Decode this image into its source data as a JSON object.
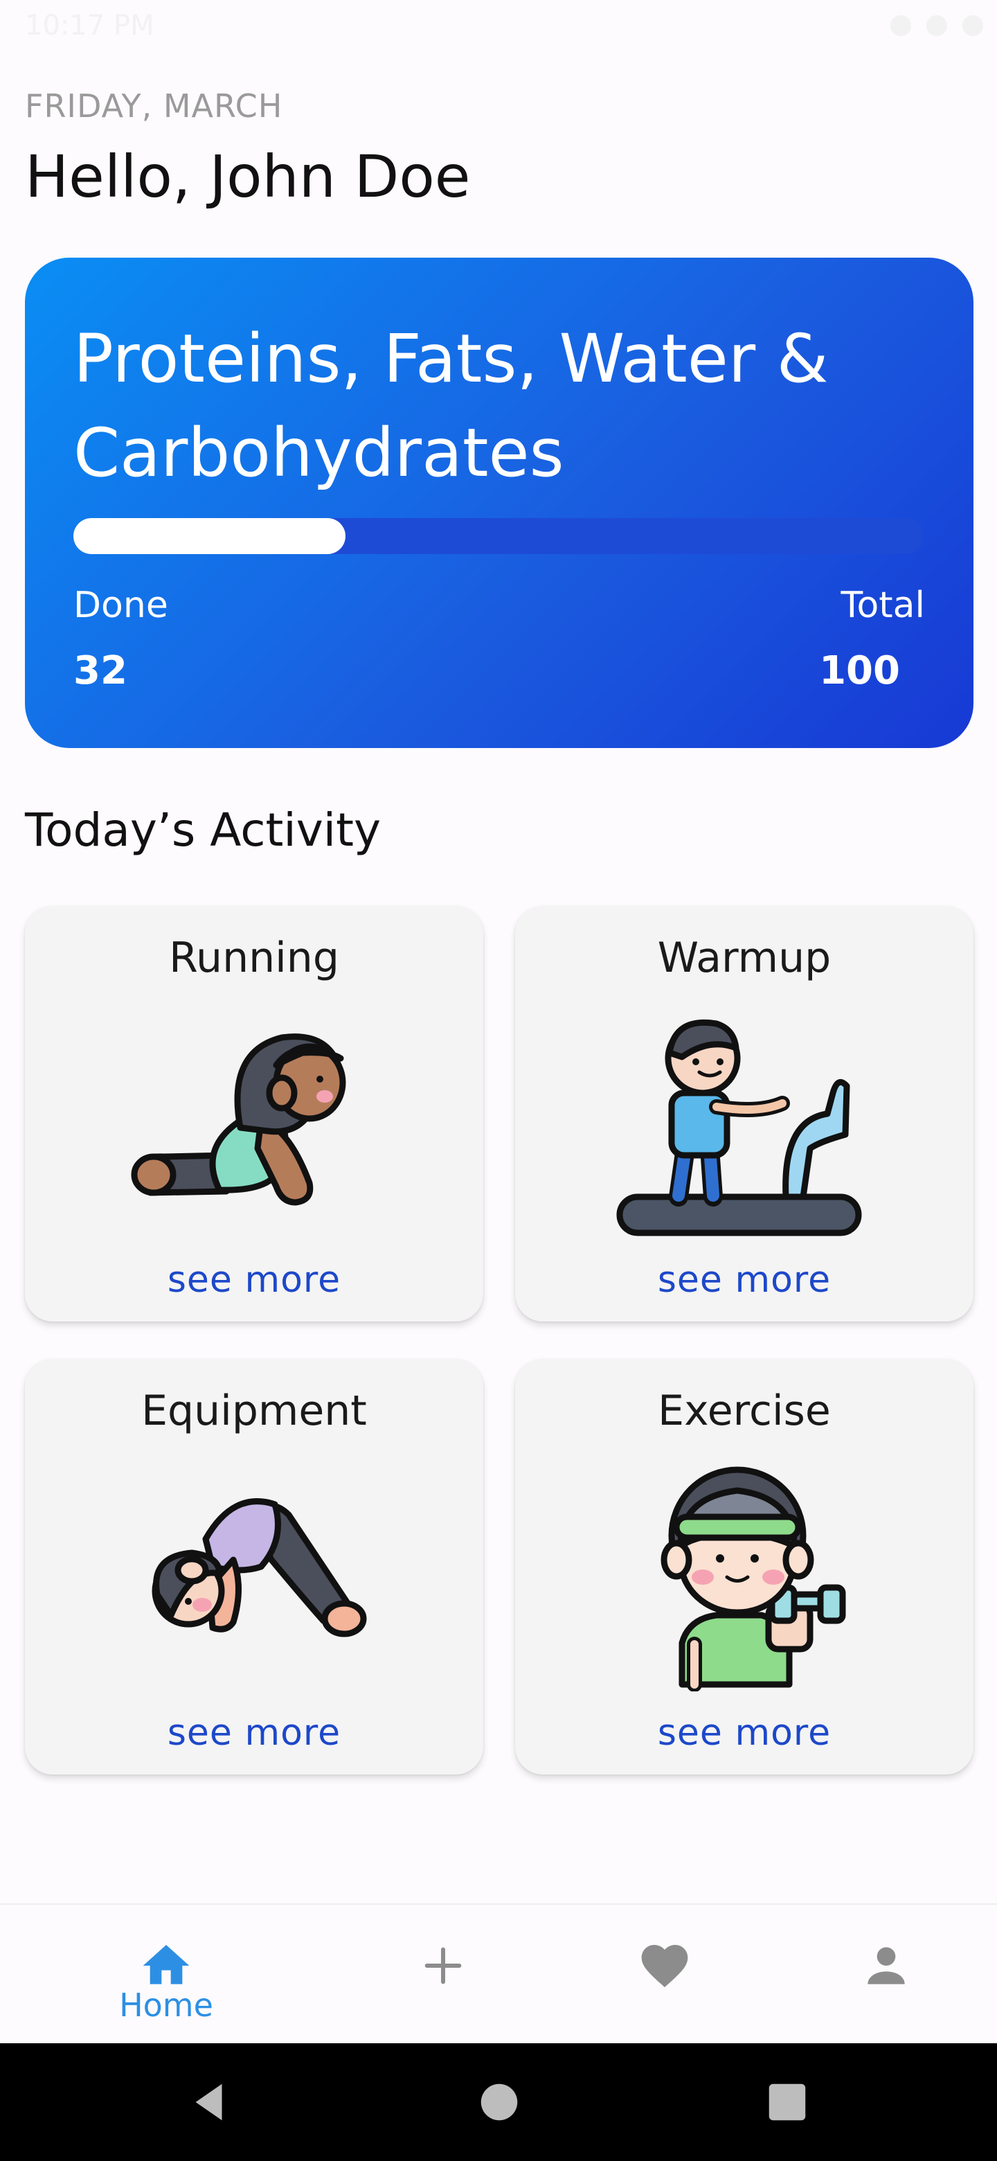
{
  "status_bar": {
    "time": "10:17 PM"
  },
  "header": {
    "date": "FRIDAY, MARCH",
    "greeting": "Hello, John Doe"
  },
  "summary": {
    "title": "Proteins, Fats, Water & Carbohydrates",
    "progress": 0.32,
    "done_label": "Done",
    "done_value": "32",
    "total_label": "Total",
    "total_value": "100",
    "colors": {
      "gradient_start": "#0a8ef4",
      "gradient_end": "#1739d4",
      "track": "#1e4bd6",
      "fill": "#ffffff"
    }
  },
  "activity": {
    "title": "Today’s Activity",
    "cards": [
      {
        "title": "Running",
        "link": "see more",
        "icon": "cobra-pose-illustration"
      },
      {
        "title": "Warmup",
        "link": "see more",
        "icon": "treadmill-illustration"
      },
      {
        "title": "Equipment",
        "link": "see more",
        "icon": "downward-dog-illustration"
      },
      {
        "title": "Exercise",
        "link": "see more",
        "icon": "dumbbell-boy-illustration"
      }
    ]
  },
  "bottom_nav": {
    "items": [
      {
        "label": "Home",
        "icon": "home-icon",
        "active": true
      },
      {
        "label": "",
        "icon": "plus-icon",
        "active": false
      },
      {
        "label": "",
        "icon": "heart-icon",
        "active": false
      },
      {
        "label": "",
        "icon": "person-icon",
        "active": false
      }
    ],
    "active_color": "#2d8fe4",
    "inactive_color": "#8c8c8c"
  }
}
